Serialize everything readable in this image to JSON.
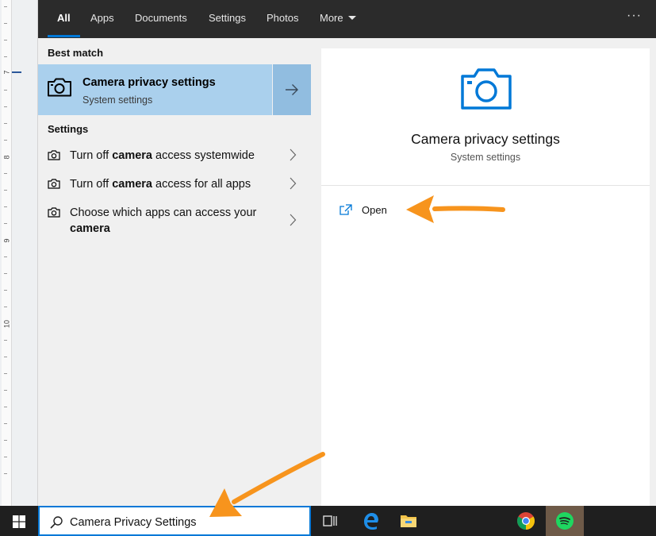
{
  "ruler": {
    "labels": [
      "7",
      "8",
      "9",
      "10"
    ]
  },
  "tabs": [
    {
      "label": "All",
      "active": true
    },
    {
      "label": "Apps"
    },
    {
      "label": "Documents"
    },
    {
      "label": "Settings"
    },
    {
      "label": "Photos"
    },
    {
      "label": "More"
    }
  ],
  "more_menu_icon": "ellipsis-icon",
  "best_match": {
    "section_label": "Best match",
    "title": "Camera privacy settings",
    "subtitle": "System settings",
    "icon": "camera-icon",
    "open_icon": "arrow-right-icon"
  },
  "settings": {
    "section_label": "Settings",
    "items": [
      {
        "before": "Turn off ",
        "bold": "camera",
        "after": " access systemwide"
      },
      {
        "before": "Turn off ",
        "bold": "camera",
        "after": " access for all apps"
      },
      {
        "before": "Choose which apps can access your ",
        "bold": "camera",
        "after": ""
      }
    ]
  },
  "details": {
    "title": "Camera privacy settings",
    "subtitle": "System settings",
    "action": "Open",
    "action_icon": "open-external-icon"
  },
  "taskbar": {
    "search_value": "Camera Privacy Settings",
    "apps": [
      "task-view-icon",
      "edge-icon",
      "file-explorer-icon",
      "chrome-icon",
      "spotify-icon"
    ]
  },
  "colors": {
    "accent": "#0078d7",
    "best_match_bg": "#aad0ed",
    "annotation_arrow": "#f7941d"
  }
}
